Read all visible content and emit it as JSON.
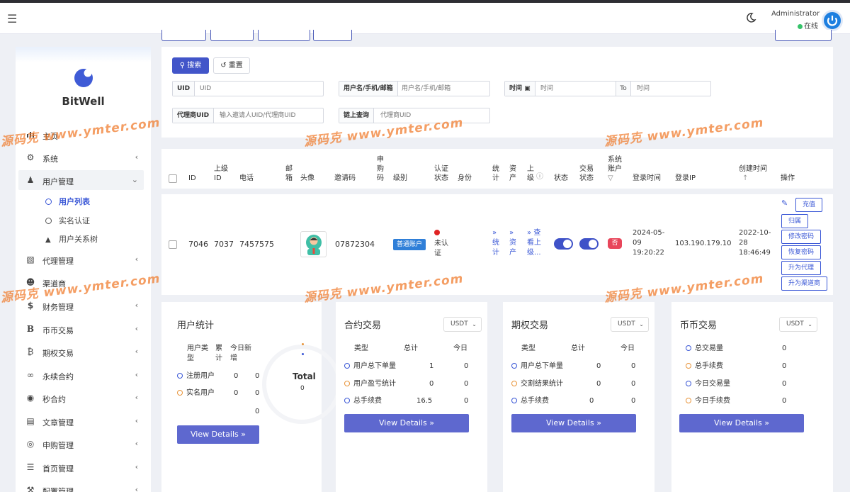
{
  "header": {
    "admin_name": "Administrator",
    "admin_status": "在线"
  },
  "sidebar": {
    "brand": "BitWell",
    "items": [
      {
        "label": "主页",
        "icon": "bar-chart-icon"
      },
      {
        "label": "系统",
        "icon": "gear-icon"
      },
      {
        "label": "用户管理",
        "icon": "users-icon"
      },
      {
        "label": "代理管理",
        "icon": "id-card-icon"
      },
      {
        "label": "渠道商",
        "icon": "user-circle-icon"
      },
      {
        "label": "财务管理",
        "icon": "dollar-icon"
      },
      {
        "label": "币币交易",
        "icon": "b-letter-icon"
      },
      {
        "label": "期权交易",
        "icon": "bitcoin-icon"
      },
      {
        "label": "永续合约",
        "icon": "link-icon"
      },
      {
        "label": "秒合约",
        "icon": "target-icon"
      },
      {
        "label": "文章管理",
        "icon": "newspaper-icon"
      },
      {
        "label": "申购管理",
        "icon": "lifebuoy-icon"
      },
      {
        "label": "首页管理",
        "icon": "list-icon"
      },
      {
        "label": "配置管理",
        "icon": "wrench-icon"
      }
    ],
    "sub_items": [
      {
        "label": "用户列表"
      },
      {
        "label": "实名认证"
      },
      {
        "label": "用户关系树"
      }
    ]
  },
  "search": {
    "search_label": "搜索",
    "reset_label": "重置",
    "uid_label": "UID",
    "uid_placeholder": "UID",
    "account_label": "用户名/手机/邮箱",
    "account_placeholder": "用户名/手机/邮箱",
    "time_label": "时间",
    "time_from_placeholder": "时间",
    "to_label": "To",
    "time_to_placeholder": "时间",
    "agent_label": "代理商UID",
    "agent_placeholder": "输入邀请人UID/代理商UID",
    "chain_label": "链上查询",
    "chain_placeholder": "代理商UID"
  },
  "table": {
    "headers": {
      "id": "ID",
      "parent_id": "上级ID",
      "phone": "电话",
      "email": "邮箱",
      "avatar": "头像",
      "invite": "邀请码",
      "purchase": "申购码",
      "level": "级别",
      "auth_status": "认证状态",
      "identity": "身份",
      "stats": "统计",
      "assets": "资产",
      "superior": "上级",
      "status": "状态",
      "trade_status": "交易状态",
      "system_account": "系统账户",
      "login_time": "登录时间",
      "login_ip": "登录IP",
      "created": "创建时间",
      "actions": "操作"
    },
    "row": {
      "id": "7046",
      "parent_id": "7037",
      "phone": "7457575",
      "invite": "07872304",
      "level": "普通账户",
      "auth": "未认证",
      "stats": "统计",
      "assets": "资产",
      "superior": "查看上级...",
      "system_account": "否",
      "login_time": "2024-05-09 19:20:22",
      "login_ip": "103.190.179.10",
      "created": "2022-10-28 18:46:49"
    },
    "ops": {
      "recharge": "充值",
      "belong": "归属",
      "change_pwd": "修改密码",
      "restore_pwd": "恢复密码",
      "to_agent": "升为代理",
      "to_channel": "升为渠道商"
    }
  },
  "cards": {
    "user": {
      "title": "用户统计",
      "col_type": "用户类型",
      "col_total": "累计",
      "col_today": "今日新增",
      "rows": [
        {
          "label": "注册用户",
          "total": "0",
          "today": "0"
        },
        {
          "label": "实名用户",
          "total": "0",
          "today": "0"
        },
        {
          "label": "",
          "total": "",
          "today": "0"
        }
      ],
      "total_label": "Total",
      "total_value": "0",
      "view": "View Details"
    },
    "contract": {
      "title": "合约交易",
      "select": "USDT",
      "col_type": "类型",
      "col_total": "总计",
      "col_today": "今日",
      "rows": [
        {
          "label": "用户总下单量",
          "total": "1",
          "today": "0"
        },
        {
          "label": "用户盈亏统计",
          "total": "0",
          "today": "0"
        },
        {
          "label": "总手续费",
          "total": "16.5",
          "today": "0"
        }
      ],
      "view": "View Details"
    },
    "options": {
      "title": "期权交易",
      "select": "USDT",
      "col_type": "类型",
      "col_total": "总计",
      "col_today": "今日",
      "rows": [
        {
          "label": "用户总下单量",
          "total": "0",
          "today": "0"
        },
        {
          "label": "交割结果统计",
          "total": "0",
          "today": "0"
        },
        {
          "label": "总手续费",
          "total": "0",
          "today": "0"
        }
      ],
      "view": "View Details"
    },
    "spot": {
      "title": "币币交易",
      "select": "USDT",
      "rows": [
        {
          "label": "总交易量",
          "value": "0"
        },
        {
          "label": "总手续费",
          "value": "0"
        },
        {
          "label": "今日交易量",
          "value": "0"
        },
        {
          "label": "今日手续费",
          "value": "0"
        }
      ],
      "view": "View Details"
    }
  },
  "watermark": {
    "cn": "源码克",
    "url": "www.ymter.com"
  },
  "colors": {
    "primary": "#4255c9",
    "link": "#3a57d6",
    "tag_blue": "#2f7fd8",
    "tag_red": "#e8465b",
    "status_online": "#36c36a"
  }
}
